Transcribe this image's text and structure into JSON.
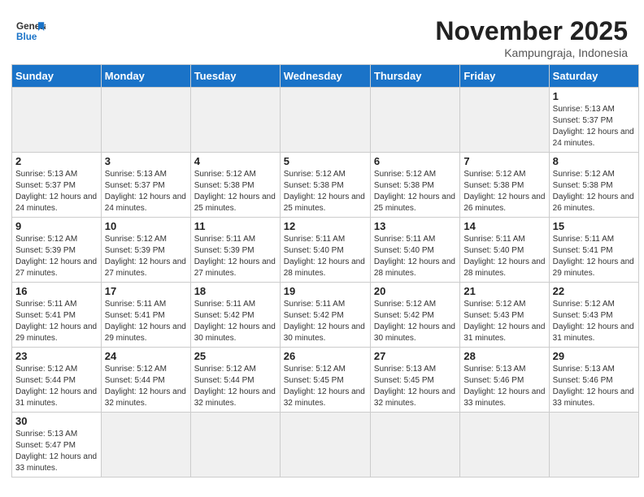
{
  "header": {
    "logo_general": "General",
    "logo_blue": "Blue",
    "month": "November 2025",
    "location": "Kampungraja, Indonesia"
  },
  "days_of_week": [
    "Sunday",
    "Monday",
    "Tuesday",
    "Wednesday",
    "Thursday",
    "Friday",
    "Saturday"
  ],
  "weeks": [
    [
      {
        "day": "",
        "empty": true
      },
      {
        "day": "",
        "empty": true
      },
      {
        "day": "",
        "empty": true
      },
      {
        "day": "",
        "empty": true
      },
      {
        "day": "",
        "empty": true
      },
      {
        "day": "",
        "empty": true
      },
      {
        "day": "1",
        "sunrise": "5:13 AM",
        "sunset": "5:37 PM",
        "daylight": "12 hours and 24 minutes."
      }
    ],
    [
      {
        "day": "2",
        "sunrise": "5:13 AM",
        "sunset": "5:37 PM",
        "daylight": "12 hours and 24 minutes."
      },
      {
        "day": "3",
        "sunrise": "5:13 AM",
        "sunset": "5:37 PM",
        "daylight": "12 hours and 24 minutes."
      },
      {
        "day": "4",
        "sunrise": "5:12 AM",
        "sunset": "5:38 PM",
        "daylight": "12 hours and 25 minutes."
      },
      {
        "day": "5",
        "sunrise": "5:12 AM",
        "sunset": "5:38 PM",
        "daylight": "12 hours and 25 minutes."
      },
      {
        "day": "6",
        "sunrise": "5:12 AM",
        "sunset": "5:38 PM",
        "daylight": "12 hours and 25 minutes."
      },
      {
        "day": "7",
        "sunrise": "5:12 AM",
        "sunset": "5:38 PM",
        "daylight": "12 hours and 26 minutes."
      },
      {
        "day": "8",
        "sunrise": "5:12 AM",
        "sunset": "5:38 PM",
        "daylight": "12 hours and 26 minutes."
      }
    ],
    [
      {
        "day": "9",
        "sunrise": "5:12 AM",
        "sunset": "5:39 PM",
        "daylight": "12 hours and 27 minutes."
      },
      {
        "day": "10",
        "sunrise": "5:12 AM",
        "sunset": "5:39 PM",
        "daylight": "12 hours and 27 minutes."
      },
      {
        "day": "11",
        "sunrise": "5:11 AM",
        "sunset": "5:39 PM",
        "daylight": "12 hours and 27 minutes."
      },
      {
        "day": "12",
        "sunrise": "5:11 AM",
        "sunset": "5:40 PM",
        "daylight": "12 hours and 28 minutes."
      },
      {
        "day": "13",
        "sunrise": "5:11 AM",
        "sunset": "5:40 PM",
        "daylight": "12 hours and 28 minutes."
      },
      {
        "day": "14",
        "sunrise": "5:11 AM",
        "sunset": "5:40 PM",
        "daylight": "12 hours and 28 minutes."
      },
      {
        "day": "15",
        "sunrise": "5:11 AM",
        "sunset": "5:41 PM",
        "daylight": "12 hours and 29 minutes."
      }
    ],
    [
      {
        "day": "16",
        "sunrise": "5:11 AM",
        "sunset": "5:41 PM",
        "daylight": "12 hours and 29 minutes."
      },
      {
        "day": "17",
        "sunrise": "5:11 AM",
        "sunset": "5:41 PM",
        "daylight": "12 hours and 29 minutes."
      },
      {
        "day": "18",
        "sunrise": "5:11 AM",
        "sunset": "5:42 PM",
        "daylight": "12 hours and 30 minutes."
      },
      {
        "day": "19",
        "sunrise": "5:11 AM",
        "sunset": "5:42 PM",
        "daylight": "12 hours and 30 minutes."
      },
      {
        "day": "20",
        "sunrise": "5:12 AM",
        "sunset": "5:42 PM",
        "daylight": "12 hours and 30 minutes."
      },
      {
        "day": "21",
        "sunrise": "5:12 AM",
        "sunset": "5:43 PM",
        "daylight": "12 hours and 31 minutes."
      },
      {
        "day": "22",
        "sunrise": "5:12 AM",
        "sunset": "5:43 PM",
        "daylight": "12 hours and 31 minutes."
      }
    ],
    [
      {
        "day": "23",
        "sunrise": "5:12 AM",
        "sunset": "5:44 PM",
        "daylight": "12 hours and 31 minutes."
      },
      {
        "day": "24",
        "sunrise": "5:12 AM",
        "sunset": "5:44 PM",
        "daylight": "12 hours and 32 minutes."
      },
      {
        "day": "25",
        "sunrise": "5:12 AM",
        "sunset": "5:44 PM",
        "daylight": "12 hours and 32 minutes."
      },
      {
        "day": "26",
        "sunrise": "5:12 AM",
        "sunset": "5:45 PM",
        "daylight": "12 hours and 32 minutes."
      },
      {
        "day": "27",
        "sunrise": "5:13 AM",
        "sunset": "5:45 PM",
        "daylight": "12 hours and 32 minutes."
      },
      {
        "day": "28",
        "sunrise": "5:13 AM",
        "sunset": "5:46 PM",
        "daylight": "12 hours and 33 minutes."
      },
      {
        "day": "29",
        "sunrise": "5:13 AM",
        "sunset": "5:46 PM",
        "daylight": "12 hours and 33 minutes."
      }
    ],
    [
      {
        "day": "30",
        "sunrise": "5:13 AM",
        "sunset": "5:47 PM",
        "daylight": "12 hours and 33 minutes."
      },
      {
        "day": "",
        "empty": true
      },
      {
        "day": "",
        "empty": true
      },
      {
        "day": "",
        "empty": true
      },
      {
        "day": "",
        "empty": true
      },
      {
        "day": "",
        "empty": true
      },
      {
        "day": "",
        "empty": true
      }
    ]
  ]
}
